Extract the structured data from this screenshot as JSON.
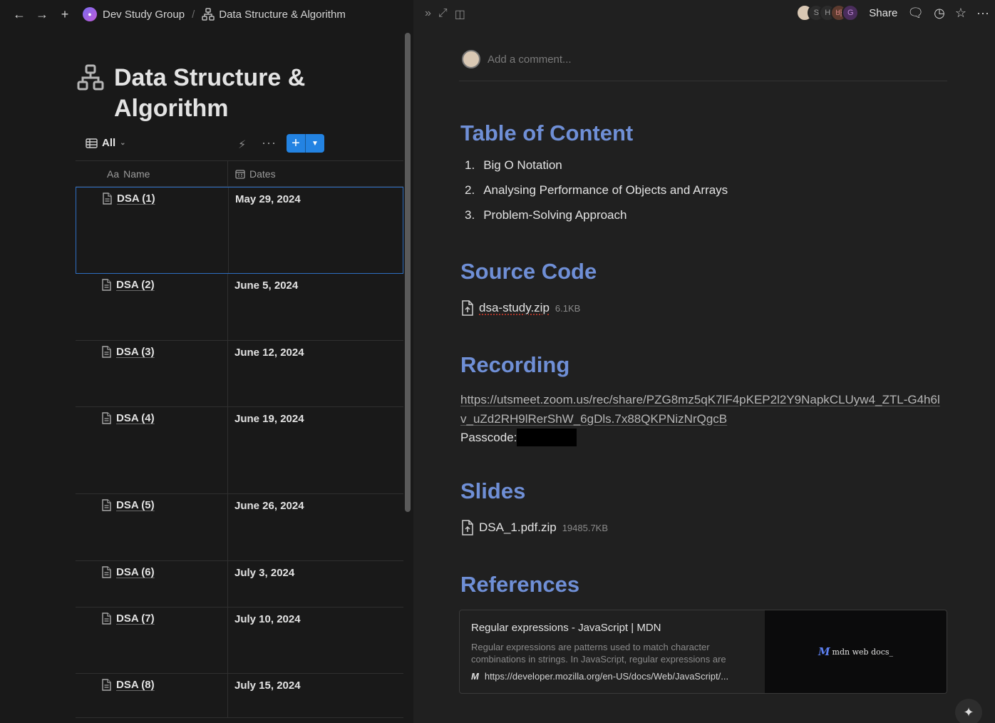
{
  "breadcrumb": {
    "workspace": "Dev Study Group",
    "separator": "/",
    "page": "Data Structure & Algorithm"
  },
  "page": {
    "title": "Data Structure & Algorithm"
  },
  "database": {
    "view_label": "All",
    "new_button_label": "+",
    "columns": {
      "name_prefix": "Aa",
      "name": "Name",
      "dates": "Dates"
    },
    "rows": [
      {
        "name": "DSA (1)",
        "date": "May 29, 2024"
      },
      {
        "name": "DSA (2)",
        "date": "June 5, 2024"
      },
      {
        "name": "DSA (3)",
        "date": "June 12, 2024"
      },
      {
        "name": "DSA (4)",
        "date": "June 19, 2024"
      },
      {
        "name": "DSA (5)",
        "date": "June 26, 2024"
      },
      {
        "name": "DSA (6)",
        "date": "July 3, 2024"
      },
      {
        "name": "DSA (7)",
        "date": "July 10, 2024"
      },
      {
        "name": "DSA (8)",
        "date": "July 15, 2024"
      }
    ]
  },
  "topbar_right": {
    "avatars": [
      "",
      "S",
      "H",
      "바",
      "G"
    ],
    "share_label": "Share"
  },
  "comment": {
    "placeholder": "Add a comment..."
  },
  "content": {
    "toc_heading": "Table of Content",
    "toc_items": [
      {
        "num": "1.",
        "text": "Big O Notation"
      },
      {
        "num": "2.",
        "text": "Analysing Performance of Objects and Arrays"
      },
      {
        "num": "3.",
        "text": "Problem-Solving Approach"
      }
    ],
    "source_heading": "Source Code",
    "source_file": {
      "name": "dsa-study.zip",
      "size": "6.1KB"
    },
    "recording_heading": "Recording",
    "recording_url": "https://utsmeet.zoom.us/rec/share/PZG8mz5qK7lF4pKEP2l2Y9NapkCLUyw4_ZTL-G4h6lv_uZd2RH9lRerShW_6gDls.7x88QKPNizNrQgcB",
    "passcode_label": "Passcode:",
    "slides_heading": "Slides",
    "slides_file": {
      "name": "DSA_1.pdf.zip",
      "size": "19485.7KB"
    },
    "references_heading": "References",
    "bookmark": {
      "title": "Regular expressions - JavaScript | MDN",
      "description": "Regular expressions are patterns used to match character combinations in strings.   In JavaScript, regular expressions are",
      "url": "https://developer.mozilla.org/en-US/docs/Web/JavaScript/...",
      "favicon": "M",
      "image_logo_mark": "M",
      "image_logo_text": "mdn web docs_"
    }
  }
}
